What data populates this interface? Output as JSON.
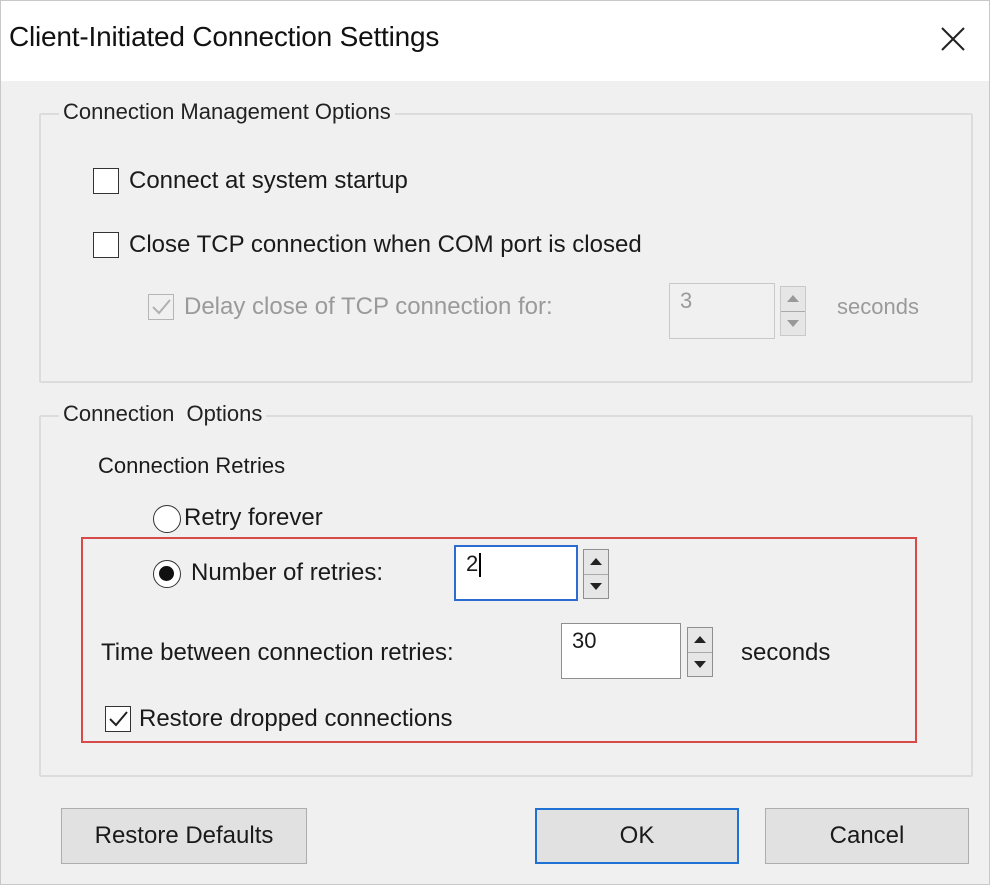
{
  "window": {
    "title": "Client-Initiated Connection Settings"
  },
  "management": {
    "legend": "Connection Management Options",
    "connect_startup": {
      "label": "Connect at system startup",
      "checked": false
    },
    "close_tcp": {
      "label": "Close TCP connection when COM port is closed",
      "checked": false
    },
    "delay_close": {
      "label": "Delay close of TCP connection for:",
      "checked": true,
      "enabled": false,
      "value": "3",
      "unit": "seconds"
    }
  },
  "options": {
    "legend": "Connection  Options",
    "retries_heading": "Connection Retries",
    "retry_forever": {
      "label": "Retry forever",
      "selected": false
    },
    "number_of_retries": {
      "label": "Number of retries:",
      "selected": true,
      "value": "2"
    },
    "time_between": {
      "label": "Time between connection retries:",
      "value": "30",
      "unit": "seconds"
    },
    "restore_dropped": {
      "label": "Restore dropped connections",
      "checked": true
    }
  },
  "buttons": {
    "restore_defaults": "Restore Defaults",
    "ok": "OK",
    "cancel": "Cancel"
  },
  "colors": {
    "highlight": "#d64a4a",
    "focus": "#2a6dcf",
    "default_button": "#1f72d4"
  }
}
